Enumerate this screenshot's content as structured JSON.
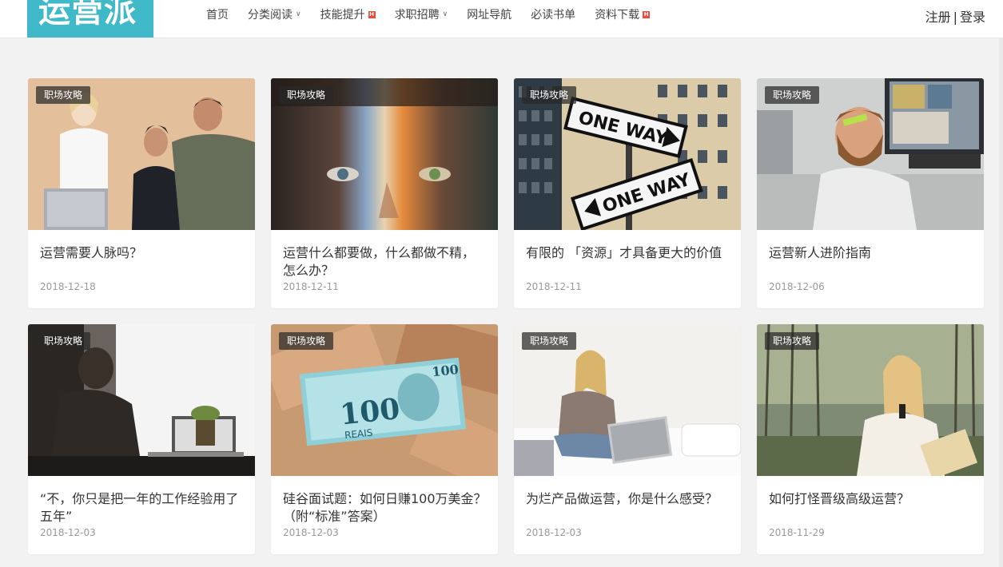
{
  "site": {
    "logo_text": "运营派"
  },
  "nav": [
    {
      "label": "首页",
      "dropdown": false,
      "badge": ""
    },
    {
      "label": "分类阅读",
      "dropdown": true,
      "badge": ""
    },
    {
      "label": "技能提升",
      "dropdown": false,
      "badge": "H"
    },
    {
      "label": "求职招聘",
      "dropdown": true,
      "badge": ""
    },
    {
      "label": "网址导航",
      "dropdown": false,
      "badge": ""
    },
    {
      "label": "必读书单",
      "dropdown": false,
      "badge": ""
    },
    {
      "label": "资料下载",
      "dropdown": false,
      "badge": "H"
    }
  ],
  "auth": {
    "register": "注册",
    "separator": "|",
    "login": "登录"
  },
  "cards": [
    {
      "tag": "职场攻略",
      "title": "运营需要人脉吗？",
      "date": "2018-12-18",
      "image": "people-at-laptop"
    },
    {
      "tag": "职场攻略",
      "title": "运营什么都要做，什么都做不精，怎么办？",
      "date": "2018-12-11",
      "image": "face-with-light"
    },
    {
      "tag": "职场攻略",
      "title": "有限的 「资源」才具备更大的价值",
      "date": "2018-12-11",
      "image": "one-way-signs"
    },
    {
      "tag": "职场攻略",
      "title": "运营新人进阶指南",
      "date": "2018-12-06",
      "image": "smiling-bearded-man"
    },
    {
      "tag": "职场攻略",
      "title": "“不，你只是把一年的工作经验用了五年”",
      "date": "2018-12-03",
      "image": "woman-at-laptop-window"
    },
    {
      "tag": "职场攻略",
      "title": "硅谷面试题：如何日赚100万美金？（附“标准”答案）",
      "date": "2018-12-03",
      "image": "banknotes"
    },
    {
      "tag": "职场攻略",
      "title": "为烂产品做运营，你是什么感受？",
      "date": "2018-12-03",
      "image": "woman-on-bed-laptop"
    },
    {
      "tag": "职场攻略",
      "title": "如何打怪晋级高级运营？",
      "date": "2018-11-29",
      "image": "woman-on-phone-outdoors"
    }
  ],
  "colors": {
    "brand": "#3fb8c8",
    "background": "#f2f2f2",
    "badge": "#e74c3c"
  }
}
